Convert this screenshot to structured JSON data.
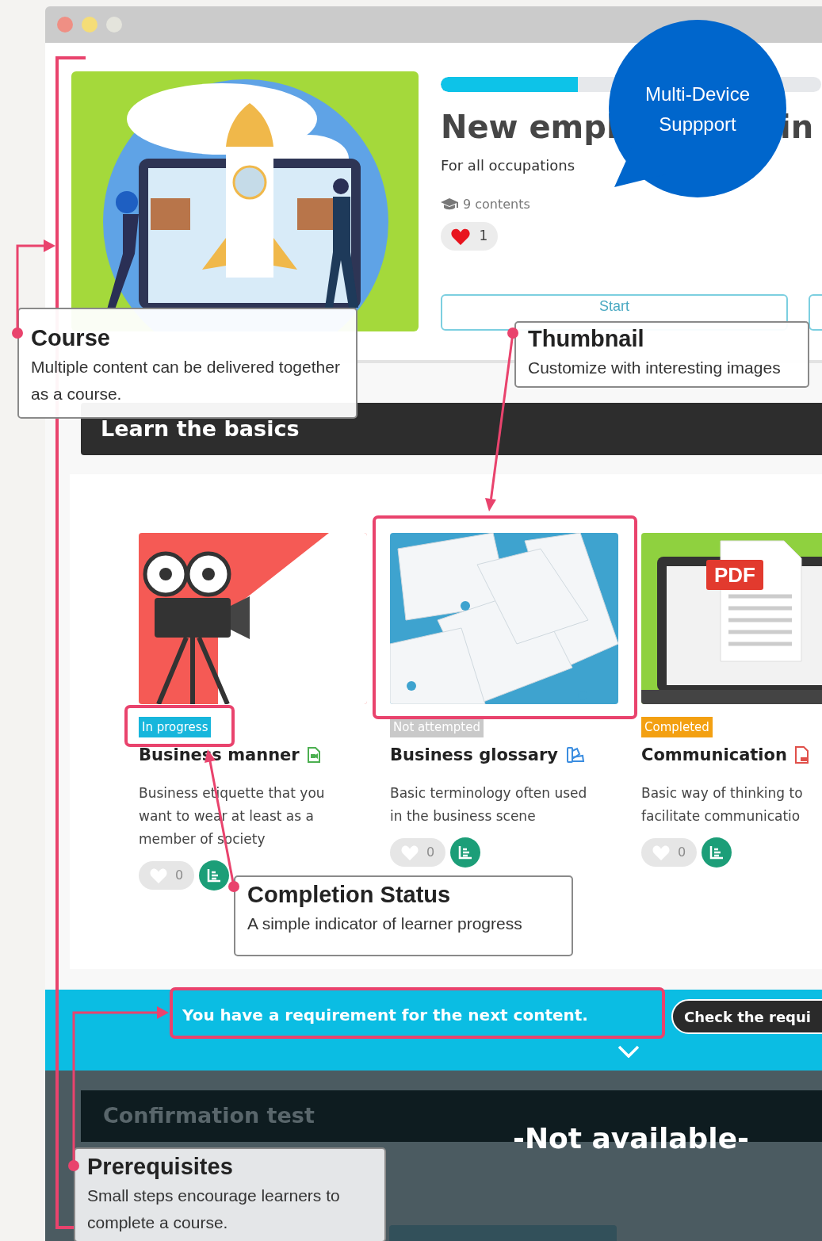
{
  "course": {
    "progress": {
      "level": 0.36
    },
    "title_start": "New empl",
    "title_end": "in",
    "subtitle": "For all occupations",
    "contents_count": "9 contents",
    "likes": "1",
    "liked": true,
    "start_button": "Start"
  },
  "section_title": "Learn the basics",
  "contents": [
    {
      "status": "In progress",
      "color": "#17b6dc",
      "title": "Business manner",
      "kind": "video",
      "description_lines": [
        "Business etiquette that you",
        "want to wear at least as a",
        "member of society"
      ],
      "likes": "0",
      "liked": false
    },
    {
      "status": "Not attempted",
      "color": "#c9c9c9",
      "title": "Business glossary",
      "kind": "quiz",
      "description_lines": [
        "Basic terminology often used",
        "in the business scene"
      ],
      "likes": "0",
      "liked": false
    },
    {
      "status": "Completed",
      "color": "#f3a012",
      "title": "Communication",
      "kind": "pdf",
      "image_label": "PDF",
      "description_lines": [
        "Basic way of thinking to",
        "facilitate communicatio"
      ],
      "likes": "0",
      "liked": false
    }
  ],
  "requirement": {
    "message": "You have a requirement for the next content.",
    "button": "Check the requi"
  },
  "locked_section": {
    "title": "Confirmation test",
    "notice": "-Not available-"
  },
  "annotations": {
    "bubble_lines": [
      "Multi-Device",
      "Suppport"
    ],
    "callouts": [
      {
        "title": "Course",
        "text": "Multiple content can be delivered together as a course."
      },
      {
        "title": "Thumbnail",
        "text": "Customize with interesting images"
      },
      {
        "title": "Completion Status",
        "text": "A simple indicator of learner progress"
      },
      {
        "title": "Prerequisites",
        "text": "Small steps encourage learners to complete a course."
      }
    ]
  }
}
